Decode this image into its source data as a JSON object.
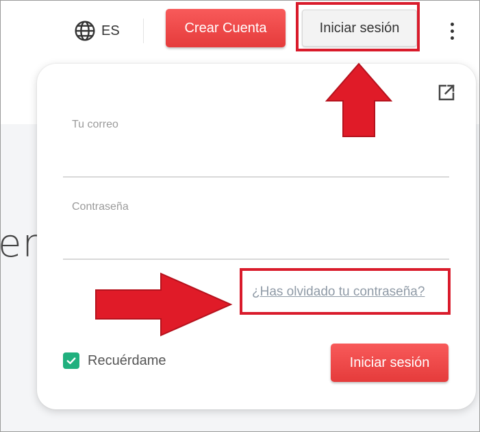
{
  "header": {
    "language": {
      "icon": "globe-icon",
      "code": "ES"
    },
    "create_account_label": "Crear Cuenta",
    "login_label": "Iniciar sesión",
    "more_icon": "kebab-menu-icon"
  },
  "background": {
    "partial_text": "er"
  },
  "login_panel": {
    "open_external_icon": "external-link-icon",
    "email_label": "Tu correo",
    "password_label": "Contraseña",
    "forgot_password": "¿Has olvidado tu contraseña?",
    "remember_me": {
      "label": "Recuérdame",
      "checked": true
    },
    "submit_label": "Iniciar sesión"
  },
  "annotations": {
    "color": "#d91b2b"
  },
  "colors": {
    "accent_red": "#ef4848",
    "checkbox_green": "#20b07e"
  }
}
